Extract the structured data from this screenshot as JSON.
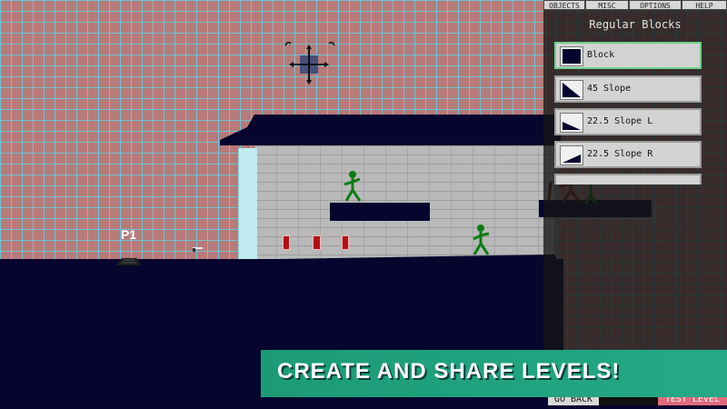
{
  "game": {
    "player_label": "P1"
  },
  "menu": {
    "tabs": [
      "OBJECTS",
      "MISC",
      "OPTIONS",
      "HELP"
    ]
  },
  "panel": {
    "title": "Regular Blocks",
    "blocks": [
      {
        "label": "Block",
        "icon": "block-icon",
        "selected": true
      },
      {
        "label": "45 Slope",
        "icon": "slope-45-icon",
        "selected": false
      },
      {
        "label": "22.5 Slope L",
        "icon": "slope-22-left-icon",
        "selected": false
      },
      {
        "label": "22.5 Slope R",
        "icon": "slope-22-right-icon",
        "selected": false
      }
    ]
  },
  "footer": {
    "go_back": "GO BACK",
    "test_level": "TEST LEVEL"
  },
  "promo": {
    "banner_text": "CREATE AND SHARE LEVELS!"
  },
  "colors": {
    "ground": "#05052e",
    "grid": "#6fc3d6",
    "enemy": "#0b7d15",
    "banner": "#1f9e7a",
    "test_level": "#e06a7c"
  }
}
